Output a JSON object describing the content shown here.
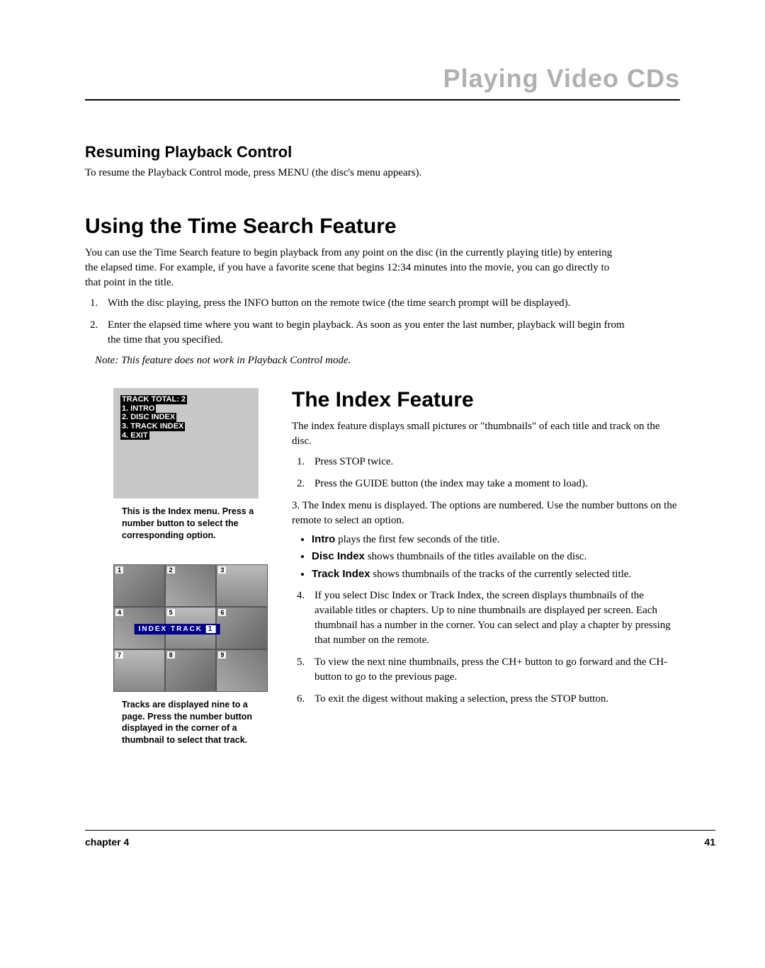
{
  "header": {
    "title": "Playing Video CDs"
  },
  "resume": {
    "heading": "Resuming Playback Control",
    "body": "To resume the Playback Control mode, press MENU (the disc's menu appears)."
  },
  "timesearch": {
    "heading": "Using the Time Search Feature",
    "body": "You can use the Time Search feature to begin playback from any point on the disc (in the currently playing title) by entering the elapsed time. For example, if you have a favorite scene that begins 12:34 minutes into the movie, you can go directly to that point in the title.",
    "step1": "With the disc playing, press the INFO button on the remote twice (the time search prompt will be displayed).",
    "step2": "Enter the elapsed time where you want to begin playback. As soon as you enter the last number, playback will begin from the time that you specified.",
    "note": "Note: This feature does not work in Playback Control mode."
  },
  "menu_screen": {
    "line0": "TRACK TOTAL: 2",
    "line1": "1. INTRO",
    "line2": "2. DISC INDEX",
    "line3": "3. TRACK INDEX",
    "line4": "4. EXIT",
    "caption": "This is the Index menu. Press a number button to select the corresponding option."
  },
  "track_grid": {
    "label": "INDEX TRACK",
    "page": "1",
    "caption": "Tracks are displayed nine to a page. Press the number button displayed in the corner of a thumbnail to select that track."
  },
  "index": {
    "heading": "The Index Feature",
    "body": "The index feature displays small pictures or \"thumbnails\" of each title and track on the disc.",
    "step1": "Press STOP twice.",
    "step2": "Press the GUIDE button (the index may take a moment to load).",
    "step3_pre": "3. The Index menu is displayed. The options are numbered. Use the number buttons on the remote to select an option.",
    "bullet1_b": "Intro",
    "bullet1_t": " plays the first few seconds of  the title.",
    "bullet2_b": "Disc Index",
    "bullet2_t": " shows thumbnails of the titles available on the disc.",
    "bullet3_b": "Track Index",
    "bullet3_t": " shows thumbnails of the tracks of the currently selected title.",
    "step4": "If you select Disc Index or Track Index, the screen displays thumbnails of the available titles or chapters. Up to nine thumbnails are displayed per screen. Each thumbnail has a number in the corner. You can select and play a chapter by pressing that number on the remote.",
    "step5": "To view the next nine thumbnails, press the CH+ button to go forward and the CH- button to go to the previous page.",
    "step6": "To exit the digest without making a selection,  press the STOP button."
  },
  "footer": {
    "chapter": "chapter 4",
    "page": "41"
  }
}
